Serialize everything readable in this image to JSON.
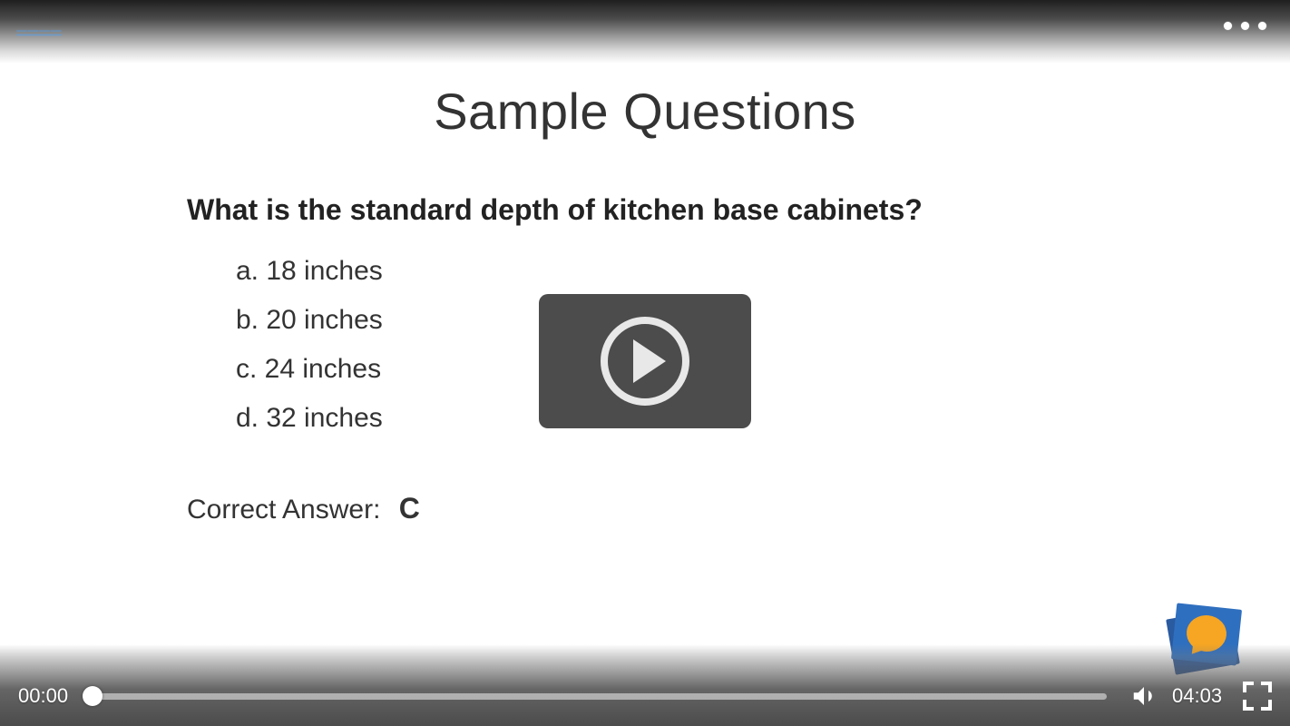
{
  "header": {
    "link_text": "————",
    "more_icon": "more-horizontal"
  },
  "slide": {
    "title": "Sample Questions",
    "question": "What is the standard depth of kitchen base cabinets?",
    "options": {
      "a": "a.  18 inches",
      "b": "b.  20 inches",
      "c": "c.  24 inches",
      "d": "d.  32 inches"
    },
    "answer_label": "Correct Answer:",
    "answer_value": "C"
  },
  "player": {
    "current_time": "00:00",
    "duration": "04:03",
    "progress_pct": 0
  }
}
